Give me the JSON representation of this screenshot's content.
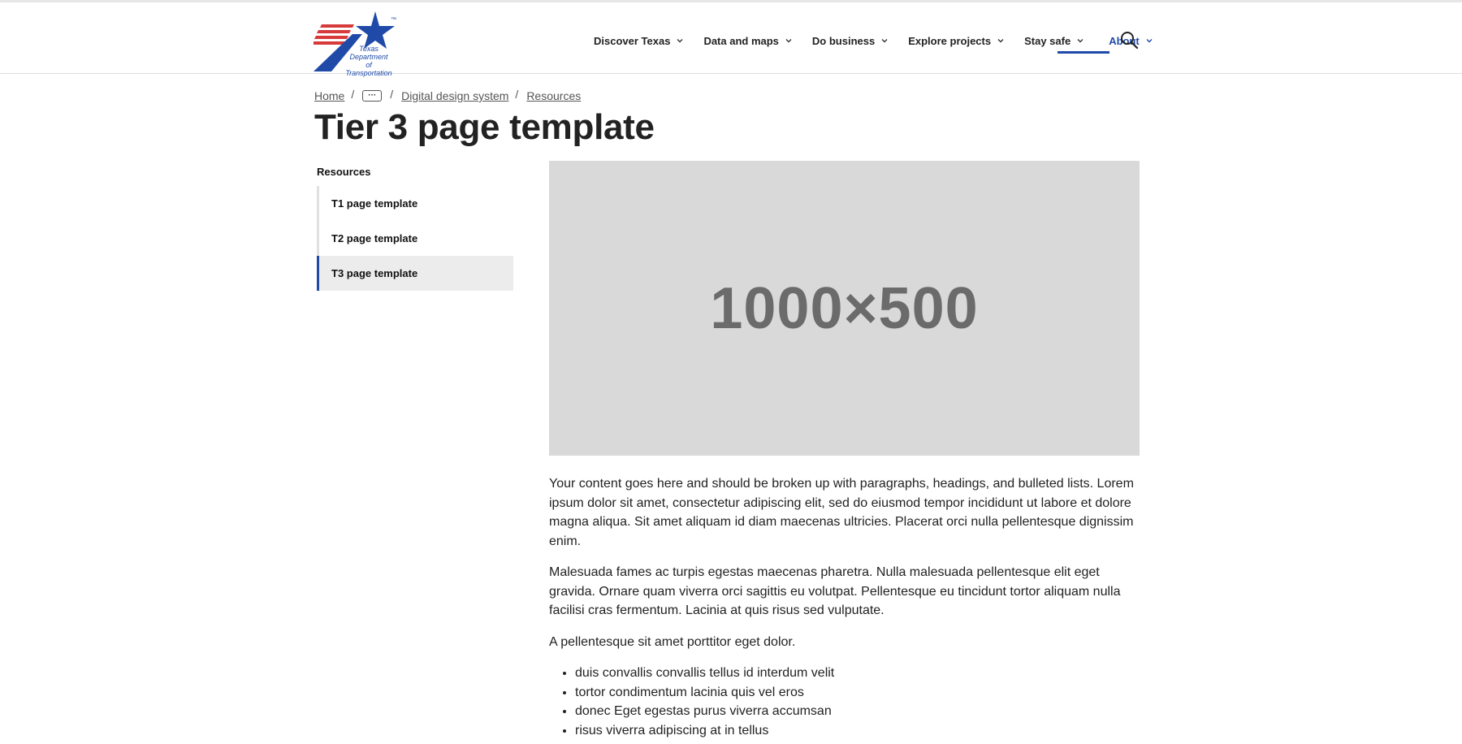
{
  "logo": {
    "text_lines": [
      "Texas",
      "Department",
      "of Transportation"
    ],
    "trademark": "™",
    "colors": {
      "blue": "#1f4aa8",
      "red": "#d63a3a"
    }
  },
  "nav": {
    "items": [
      {
        "label": "Discover Texas"
      },
      {
        "label": "Data and maps"
      },
      {
        "label": "Do business"
      },
      {
        "label": "Explore projects"
      },
      {
        "label": "Stay safe"
      },
      {
        "label": "About"
      }
    ],
    "active_index": 5,
    "search_icon": "search-icon"
  },
  "breadcrumb": {
    "items": [
      {
        "label": "Home"
      },
      {
        "label": "···"
      },
      {
        "label": "Digital design system"
      },
      {
        "label": "Resources"
      }
    ],
    "separator": "/"
  },
  "page": {
    "title": "Tier 3 page template"
  },
  "sidebar": {
    "heading": "Resources",
    "items": [
      {
        "label": "T1 page template"
      },
      {
        "label": "T2 page template"
      },
      {
        "label": "T3 page template"
      }
    ],
    "active_index": 2
  },
  "image_placeholder": {
    "label": "1000×500"
  },
  "content": {
    "paragraphs": [
      "Your content goes here and should be broken up with paragraphs, headings, and bulleted lists. Lorem ipsum dolor sit amet, consectetur adipiscing elit, sed do eiusmod tempor incididunt ut labore et dolore magna aliqua. Sit amet aliquam id diam maecenas ultricies. Placerat orci nulla pellentesque dignissim enim.",
      "Malesuada fames ac turpis egestas maecenas pharetra. Nulla malesuada pellentesque elit eget gravida. Ornare quam viverra orci sagittis eu volutpat. Pellentesque eu tincidunt tortor aliquam nulla facilisi cras fermentum. Lacinia at quis risus sed vulputate.",
      "A pellentesque sit amet porttitor eget dolor."
    ],
    "bullets": [
      "duis convallis convallis tellus id interdum velit",
      "tortor condimentum lacinia quis vel eros",
      "donec Eget egestas purus viverra accumsan",
      "risus viverra adipiscing at in tellus"
    ]
  }
}
